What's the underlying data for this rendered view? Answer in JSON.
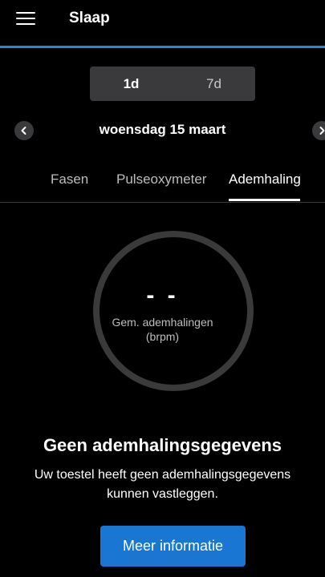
{
  "app_bar": {
    "title": "Slaap",
    "menu_icon": "hamburger-icon"
  },
  "colors": {
    "accent_line": "#1a8fd8",
    "button": "#1976d2",
    "background": "#000000"
  },
  "range_toggle": {
    "options": [
      "1d",
      "7d"
    ],
    "selected": "1d"
  },
  "date_nav": {
    "label": "woensdag 15 maart",
    "prev_icon": "chevron-left-icon",
    "next_icon": "chevron-right-icon"
  },
  "tabs": [
    {
      "label": "Fasen"
    },
    {
      "label": "Pulseoxymeter"
    },
    {
      "label": "Ademhaling"
    }
  ],
  "active_tab": "Ademhaling",
  "ring": {
    "value": "- -",
    "label_line1": "Gem. ademhalingen",
    "label_line2": "(brpm)"
  },
  "empty_state": {
    "title": "Geen ademhalingsgegevens",
    "description": "Uw toestel heeft geen ademhalingsgegevens kunnen vastleggen.",
    "button_label": "Meer informatie"
  }
}
